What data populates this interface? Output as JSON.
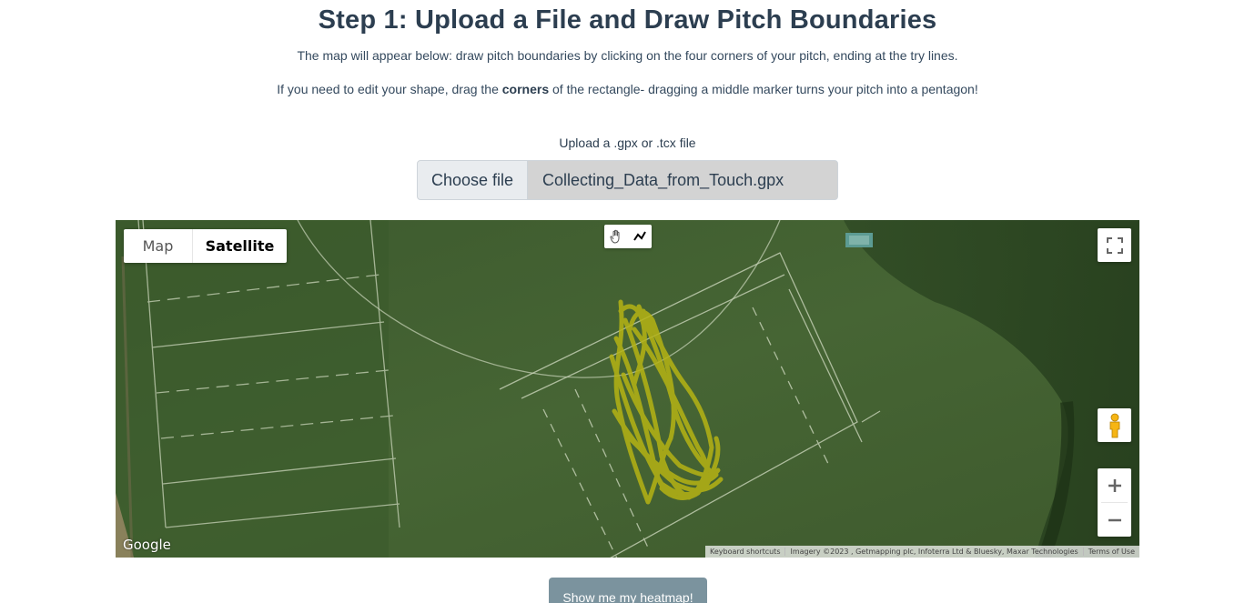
{
  "header": {
    "title": "Step 1: Upload a File and Draw Pitch Boundaries",
    "instruction1": "The map will appear below: draw pitch boundaries by clicking on the four corners of your pitch, ending at the try lines.",
    "instruction2_prefix": "If you need to edit your shape, drag the ",
    "instruction2_bold": "corners",
    "instruction2_suffix": " of the rectangle- dragging a middle marker turns your pitch into a pentagon!"
  },
  "upload": {
    "label": "Upload a .gpx or .tcx file",
    "button_label": "Choose file",
    "file_name": "Collecting_Data_from_Touch.gpx"
  },
  "map": {
    "map_type_options": [
      "Map",
      "Satellite"
    ],
    "selected_map_type": "Satellite",
    "logo": "Google",
    "attribution": {
      "shortcuts": "Keyboard shortcuts",
      "imagery": "Imagery ©2023 , Getmapping plc, Infoterra Ltd & Bluesky, Maxar Technologies",
      "terms": "Terms of Use"
    },
    "controls": {
      "pan_tool_icon": "hand-icon",
      "draw_tool_icon": "polyline-icon",
      "fullscreen_icon": "fullscreen-icon",
      "streetview_icon": "pegman-icon",
      "zoom_in_symbol": "+",
      "zoom_out_symbol": "−"
    },
    "track_color": "#b5b314"
  },
  "actions": {
    "heatmap_button": "Show me my heatmap!"
  }
}
